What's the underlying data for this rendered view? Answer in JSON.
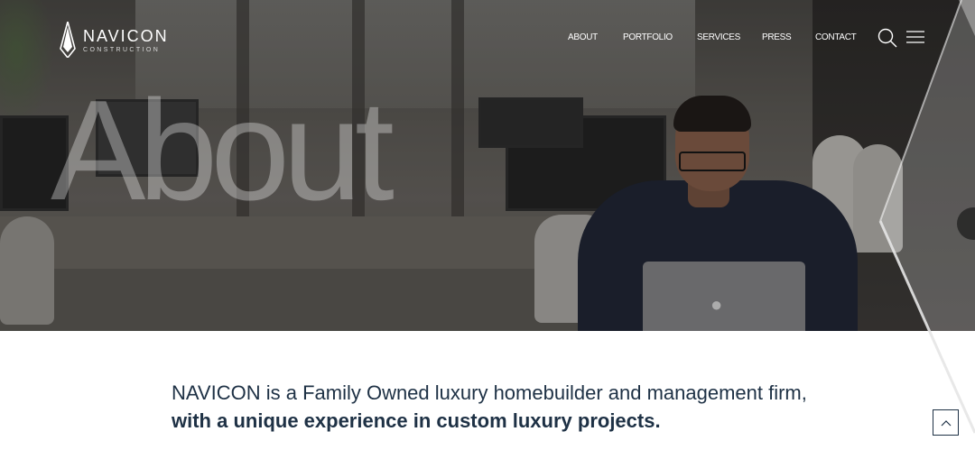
{
  "brand": {
    "name": "NAVICON",
    "subtitle": "CONSTRUCTION"
  },
  "nav": {
    "items": [
      {
        "label": "ABOUT"
      },
      {
        "label": "PORTFOLIO"
      },
      {
        "label": "SERVICES"
      },
      {
        "label": "PRESS"
      },
      {
        "label": "CONTACT"
      }
    ],
    "search_icon": "search-icon",
    "menu_icon": "hamburger-menu-icon"
  },
  "hero": {
    "title": "About"
  },
  "intro": {
    "line1": "NAVICON is a Family Owned luxury homebuilder and management firm,",
    "line2": "with a unique experience in custom luxury projects."
  },
  "back_to_top": {
    "icon": "chevron-up-icon"
  },
  "colors": {
    "text_dark": "#1e3145",
    "white": "#ffffff"
  }
}
